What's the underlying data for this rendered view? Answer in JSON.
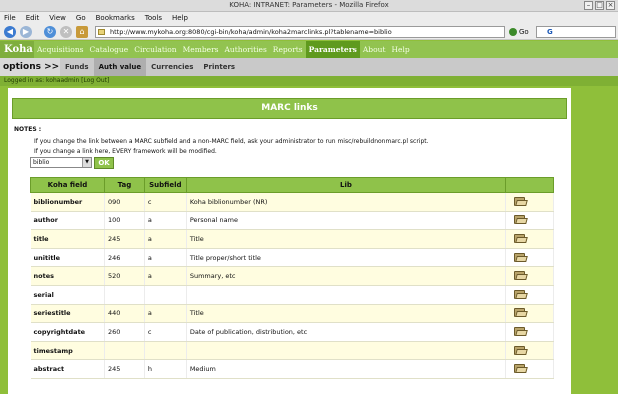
{
  "window": {
    "title": "KOHA: INTRANET: Parameters - Mozilla Firefox"
  },
  "menu": [
    "File",
    "Edit",
    "View",
    "Go",
    "Bookmarks",
    "Tools",
    "Help"
  ],
  "nav": {
    "url": "http://www.mykoha.org:8080/cgi-bin/koha/admin/koha2marclinks.pl?tablename=biblio",
    "go_label": "Go",
    "search_value": "G"
  },
  "koha": {
    "logo": "Koha",
    "tabs": [
      "Acquisitions",
      "Catalogue",
      "Circulation",
      "Members",
      "Authorities",
      "Reports",
      "Parameters",
      "About",
      "Help"
    ]
  },
  "options": {
    "title": "options >>",
    "items": [
      "Funds",
      "Auth value",
      "Currencies",
      "Printers"
    ]
  },
  "login": {
    "text": "Logged in as:  kohaadmin [Log Out]"
  },
  "page": {
    "heading": "MARC links",
    "notes_label": "NOTES :",
    "note1": "If you change the link between a MARC subfield and a non-MARC field, ask your administrator to run misc/rebuildnonmarc.pl script.",
    "note2": "If you change a link here, EVERY framework will be modified.",
    "framework_selected": "biblio",
    "ok_label": "OK"
  },
  "table": {
    "headers": [
      "Koha field",
      "Tag",
      "Subfield",
      "Lib",
      ""
    ],
    "rows": [
      {
        "field": "biblionumber",
        "tag": "090",
        "subfield": "c",
        "lib": "Koha biblionumber (NR)"
      },
      {
        "field": "author",
        "tag": "100",
        "subfield": "a",
        "lib": "Personal name"
      },
      {
        "field": "title",
        "tag": "245",
        "subfield": "a",
        "lib": "Title"
      },
      {
        "field": "unititle",
        "tag": "246",
        "subfield": "a",
        "lib": "Title proper/short title"
      },
      {
        "field": "notes",
        "tag": "520",
        "subfield": "a",
        "lib": "Summary, etc"
      },
      {
        "field": "serial",
        "tag": "",
        "subfield": "",
        "lib": ""
      },
      {
        "field": "seriestitle",
        "tag": "440",
        "subfield": "a",
        "lib": "Title"
      },
      {
        "field": "copyrightdate",
        "tag": "260",
        "subfield": "c",
        "lib": "Date of publication, distribution, etc"
      },
      {
        "field": "timestamp",
        "tag": "",
        "subfield": "",
        "lib": ""
      },
      {
        "field": "abstract",
        "tag": "245",
        "subfield": "h",
        "lib": "Medium"
      }
    ]
  }
}
